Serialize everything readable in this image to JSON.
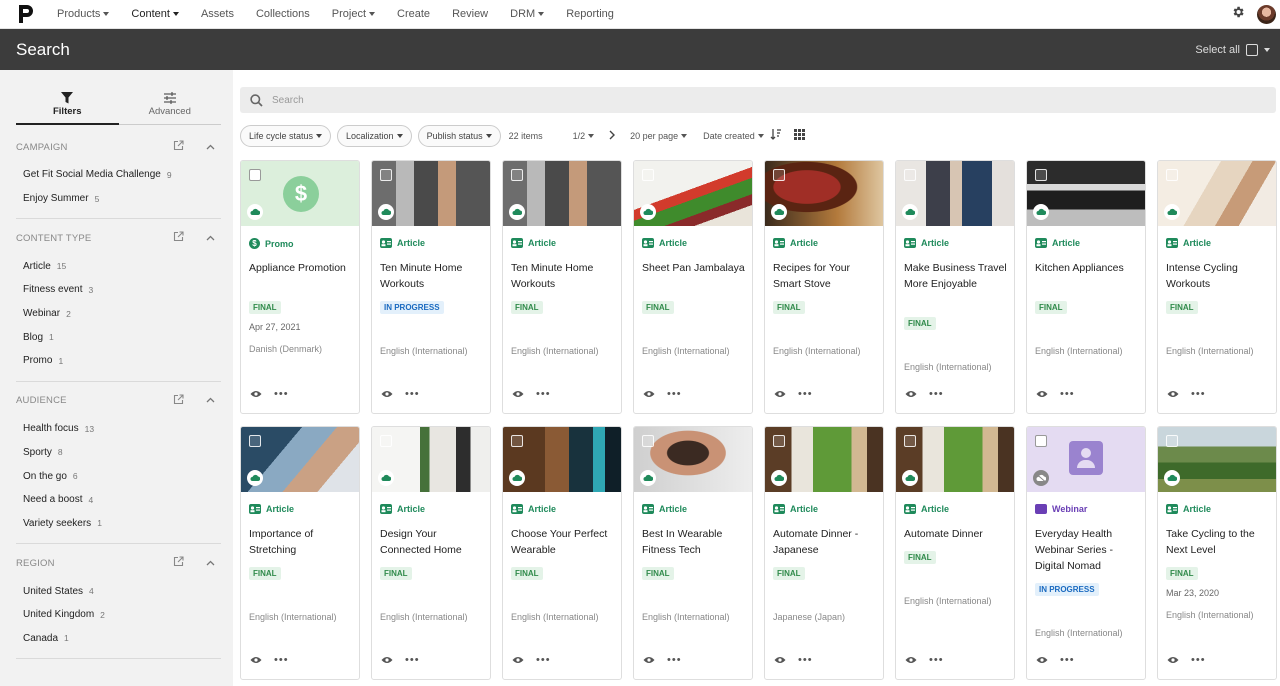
{
  "nav": {
    "items": [
      {
        "label": "Products",
        "dropdown": true
      },
      {
        "label": "Content",
        "dropdown": true,
        "active": true
      },
      {
        "label": "Assets",
        "dropdown": false
      },
      {
        "label": "Collections",
        "dropdown": false
      },
      {
        "label": "Project",
        "dropdown": true
      },
      {
        "label": "Create",
        "dropdown": false
      },
      {
        "label": "Review",
        "dropdown": false
      },
      {
        "label": "DRM",
        "dropdown": true
      },
      {
        "label": "Reporting",
        "dropdown": false
      }
    ]
  },
  "header": {
    "title": "Search",
    "select_all": "Select all"
  },
  "sidebar": {
    "tabs": [
      {
        "label": "Filters",
        "icon": "filter-icon"
      },
      {
        "label": "Advanced",
        "icon": "sliders-icon"
      }
    ],
    "facets": [
      {
        "title": "CAMPAIGN",
        "items": [
          {
            "label": "Get Fit Social Media Challenge",
            "count": "9"
          },
          {
            "label": "Enjoy Summer",
            "count": "5"
          }
        ]
      },
      {
        "title": "CONTENT TYPE",
        "items": [
          {
            "label": "Article",
            "count": "15"
          },
          {
            "label": "Fitness event",
            "count": "3"
          },
          {
            "label": "Webinar",
            "count": "2"
          },
          {
            "label": "Blog",
            "count": "1"
          },
          {
            "label": "Promo",
            "count": "1"
          }
        ]
      },
      {
        "title": "AUDIENCE",
        "items": [
          {
            "label": "Health focus",
            "count": "13"
          },
          {
            "label": "Sporty",
            "count": "8"
          },
          {
            "label": "On the go",
            "count": "6"
          },
          {
            "label": "Need a boost",
            "count": "4"
          },
          {
            "label": "Variety seekers",
            "count": "1"
          }
        ]
      },
      {
        "title": "REGION",
        "items": [
          {
            "label": "United States",
            "count": "4"
          },
          {
            "label": "United Kingdom",
            "count": "2"
          },
          {
            "label": "Canada",
            "count": "1"
          }
        ]
      }
    ]
  },
  "search": {
    "placeholder": "Search"
  },
  "filterbar": {
    "chips": [
      "Life cycle status",
      "Localization",
      "Publish status"
    ],
    "item_count": "22 items",
    "page": "1/2",
    "per_page": "20 per page",
    "sort": "Date created"
  },
  "cards": [
    {
      "type": "Promo",
      "title": "Appliance Promotion",
      "status": "FINAL",
      "date": "Apr 27, 2021",
      "language": "Danish (Denmark)",
      "thumb": "promo"
    },
    {
      "type": "Article",
      "title": "Ten Minute Home Workouts",
      "status": "IN PROGRESS",
      "date": "",
      "language": "English (International)",
      "thumb": "gym"
    },
    {
      "type": "Article",
      "title": "Ten Minute Home Workouts",
      "status": "FINAL",
      "date": "",
      "language": "English (International)",
      "thumb": "gym"
    },
    {
      "type": "Article",
      "title": "Sheet Pan Jambalaya",
      "status": "FINAL",
      "date": "",
      "language": "English (International)",
      "thumb": "veg"
    },
    {
      "type": "Article",
      "title": "Recipes for Your Smart Stove",
      "status": "FINAL",
      "date": "",
      "language": "English (International)",
      "thumb": "steak"
    },
    {
      "type": "Article",
      "title": "Make Business Travel More Enjoyable",
      "status": "FINAL",
      "date": "",
      "language": "English (International)",
      "thumb": "business"
    },
    {
      "type": "Article",
      "title": "Kitchen Appliances",
      "status": "FINAL",
      "date": "",
      "language": "English (International)",
      "thumb": "kitchen"
    },
    {
      "type": "Article",
      "title": "Intense Cycling Workouts",
      "status": "FINAL",
      "date": "",
      "language": "English (International)",
      "thumb": "cycling"
    },
    {
      "type": "Article",
      "title": "Importance of Stretching",
      "status": "FINAL",
      "date": "",
      "language": "English (International)",
      "thumb": "stretch"
    },
    {
      "type": "Article",
      "title": "Design Your Connected Home",
      "status": "FINAL",
      "date": "",
      "language": "English (International)",
      "thumb": "home"
    },
    {
      "type": "Article",
      "title": "Choose Your Perfect Wearable",
      "status": "FINAL",
      "date": "",
      "language": "English (International)",
      "thumb": "wearable"
    },
    {
      "type": "Article",
      "title": "Best In Wearable Fitness Tech",
      "status": "FINAL",
      "date": "",
      "language": "English (International)",
      "thumb": "pushup"
    },
    {
      "type": "Article",
      "title": "Automate Dinner - Japanese",
      "status": "FINAL",
      "date": "",
      "language": "Japanese (Japan)",
      "thumb": "dinner"
    },
    {
      "type": "Article",
      "title": "Automate Dinner",
      "status": "FINAL",
      "date": "",
      "language": "English (International)",
      "thumb": "dinner"
    },
    {
      "type": "Webinar",
      "title": "Everyday Health Webinar Series - Digital Nomad",
      "status": "IN PROGRESS",
      "date": "",
      "language": "English (International)",
      "thumb": "webinar"
    },
    {
      "type": "Article",
      "title": "Take Cycling to the Next Level",
      "status": "FINAL",
      "date": "Mar 23, 2020",
      "language": "English (International)",
      "thumb": "landscape"
    }
  ]
}
